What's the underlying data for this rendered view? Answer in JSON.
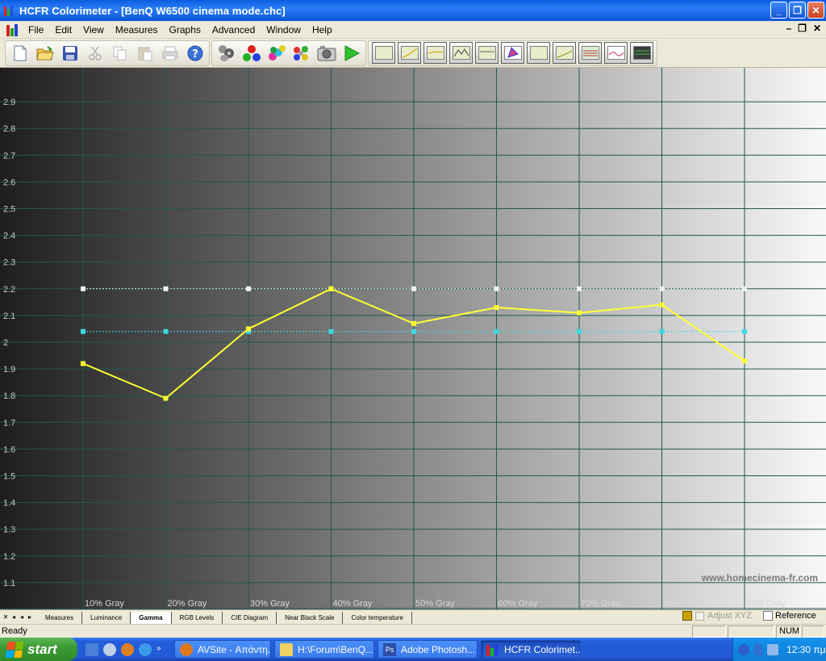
{
  "window": {
    "title": "HCFR Colorimeter - [BenQ W6500 cinema mode.chc]",
    "minimize_label": "_",
    "restore_label": "❐",
    "close_label": "✕"
  },
  "menu": {
    "items": [
      "File",
      "Edit",
      "View",
      "Measures",
      "Graphs",
      "Advanced",
      "Window",
      "Help"
    ],
    "mdi": [
      "–",
      "❐",
      "✕"
    ]
  },
  "toolbar": {
    "file_icons": [
      "new-document-icon",
      "open-folder-icon",
      "save-disk-icon",
      "cut-icon",
      "copy-icon",
      "paste-icon",
      "print-icon",
      "help-icon"
    ],
    "measure_icons": [
      "sensor-icon",
      "rgb-balls-icon",
      "color-measure-icon",
      "multi-color-icon",
      "camera-icon",
      "play-icon"
    ],
    "graph_icons": [
      "graph-luminance-icon",
      "graph-gamma-icon",
      "graph-rgb-icon",
      "graph-mountains-icon",
      "graph-colortemp-icon",
      "graph-cie-icon",
      "graph-nearblack-icon",
      "graph-nearwhite-icon",
      "graph-saturation-icon",
      "graph-levels-icon",
      "graph-dark-icon"
    ]
  },
  "chart_data": {
    "type": "line",
    "categories": [
      "10% Gray",
      "20% Gray",
      "30% Gray",
      "40% Gray",
      "50% Gray",
      "60% Gray",
      "70% Gray",
      "80% Gray",
      "90% Gray"
    ],
    "ylim": [
      1.0,
      3.0
    ],
    "yticks": [
      "1.1",
      "1.2",
      "1.3",
      "1.4",
      "1.5",
      "1.6",
      "1.7",
      "1.8",
      "1.9",
      "2",
      "2.1",
      "2.2",
      "2.3",
      "2.4",
      "2.5",
      "2.6",
      "2.7",
      "2.8",
      "2.9"
    ],
    "grid": true,
    "series": [
      {
        "color": "#ffff33",
        "style": "solid",
        "values": [
          1.92,
          1.79,
          2.05,
          2.2,
          2.07,
          2.13,
          2.11,
          2.14,
          1.93
        ]
      },
      {
        "color": "#3fd8e0",
        "style": "dotted",
        "values": [
          2.04,
          2.04,
          2.04,
          2.04,
          2.04,
          2.04,
          2.04,
          2.04,
          2.04
        ]
      },
      {
        "color": "#f0f0f0",
        "style": "dotted",
        "values": [
          2.2,
          2.2,
          2.2,
          2.2,
          2.2,
          2.2,
          2.2,
          2.2,
          2.2
        ]
      }
    ],
    "watermark": "www.homecinema-fr.com"
  },
  "tabs": {
    "items": [
      "Measures",
      "Luminance",
      "Gamma",
      "RGB Levels",
      "CIE Diagram",
      "Near Black Scale",
      "Color temperature"
    ],
    "active": "Gamma",
    "nav": [
      "✕",
      "◂",
      "◂",
      "▸"
    ]
  },
  "adjust_xyz_label": "Adjust XYZ",
  "reference_label": "Reference",
  "status": {
    "text": "Ready",
    "num": "NUM"
  },
  "taskbar": {
    "start_label": "start",
    "tasks": [
      {
        "label": "AVSite - Απάντη...",
        "icon": "firefox-icon",
        "color": "#e07820"
      },
      {
        "label": "H:\\Forum\\BenQ...",
        "icon": "folder-icon",
        "color": "#f0d060"
      },
      {
        "label": "Adobe Photosh...",
        "icon": "photoshop-icon",
        "color": "#2a4ea8"
      },
      {
        "label": "HCFR Colorimet...",
        "icon": "hcfr-icon",
        "color": "#8a2a8a"
      }
    ],
    "clock": "12:30 πμ"
  }
}
